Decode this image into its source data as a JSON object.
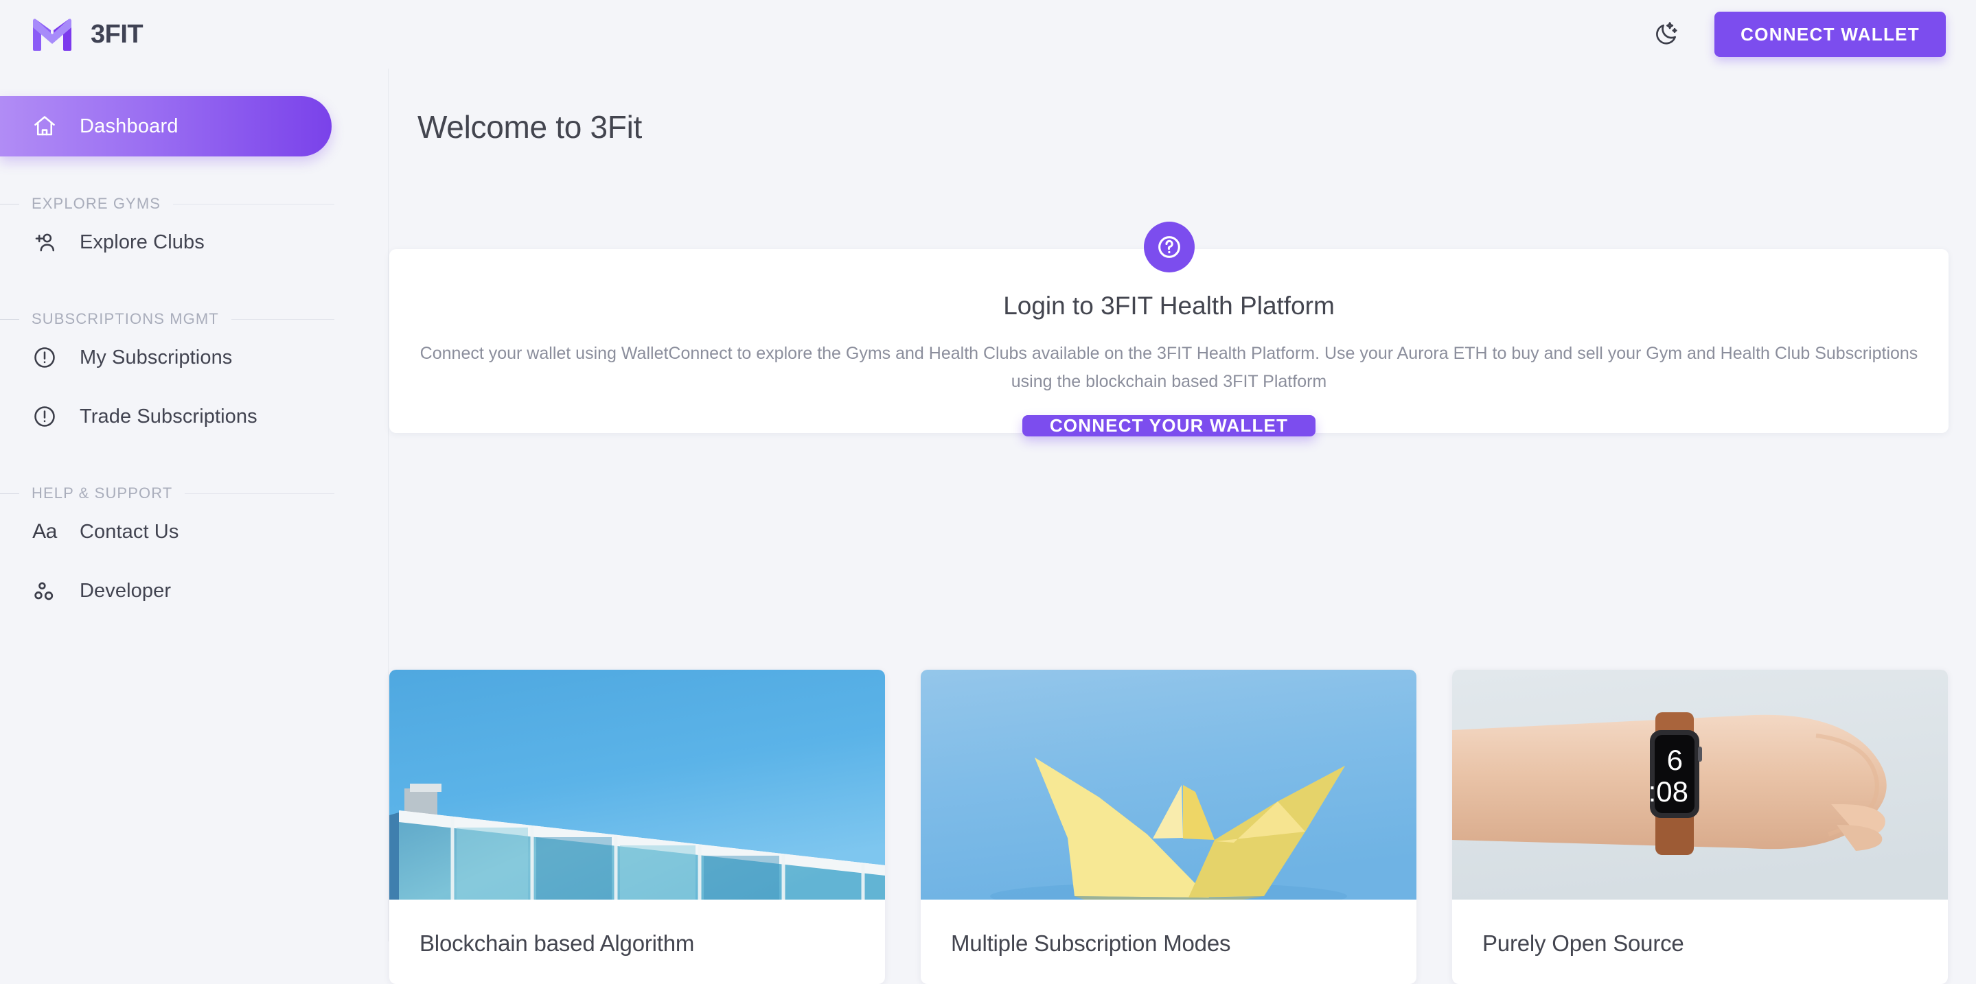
{
  "brand": {
    "name": "3FIT",
    "logo_icon": "m-logo-icon"
  },
  "topbar": {
    "theme_toggle_icon": "moon-stars-icon",
    "connect_wallet_label": "CONNECT WALLET"
  },
  "sidebar": {
    "active_item": {
      "label": "Dashboard",
      "icon": "home-icon"
    },
    "sections": [
      {
        "title": "EXPLORE GYMS",
        "items": [
          {
            "label": "Explore Clubs",
            "icon": "person-add-icon"
          }
        ]
      },
      {
        "title": "SUBSCRIPTIONS MGMT",
        "items": [
          {
            "label": "My Subscriptions",
            "icon": "exclamation-circle-icon"
          },
          {
            "label": "Trade Subscriptions",
            "icon": "exclamation-circle-icon"
          }
        ]
      },
      {
        "title": "HELP & SUPPORT",
        "items": [
          {
            "label": "Contact Us",
            "icon": "aa-text-icon"
          },
          {
            "label": "Developer",
            "icon": "bubble-chart-icon"
          }
        ]
      }
    ]
  },
  "main": {
    "page_title": "Welcome to 3Fit",
    "login_card": {
      "badge_icon": "help-question-circle-icon",
      "title": "Login to 3FIT Health Platform",
      "description": "Connect your wallet using WalletConnect to explore the Gyms and Health Clubs available on the 3FIT Health Platform. Use your Aurora ETH to buy and sell your Gym and Health Club Subscriptions using the blockchain based 3FIT Platform",
      "cta_label": "CONNECT YOUR WALLET"
    },
    "feature_cards": [
      {
        "title": "Blockchain based Algorithm",
        "image_alt": "blue-glass-building-photo"
      },
      {
        "title": "Multiple Subscription Modes",
        "image_alt": "yellow-paper-boat-photo"
      },
      {
        "title": "Purely Open Source",
        "image_alt": "wrist-smartwatch-photo",
        "image_detail_time": "6:08"
      }
    ]
  },
  "colors": {
    "accent": "#7c4dee",
    "accent_light": "#b18cf5",
    "page_bg": "#f4f5f9",
    "card_bg": "#ffffff",
    "text_primary": "#43454f",
    "text_muted": "#8b8e9c",
    "section_label": "#a9adbb"
  }
}
